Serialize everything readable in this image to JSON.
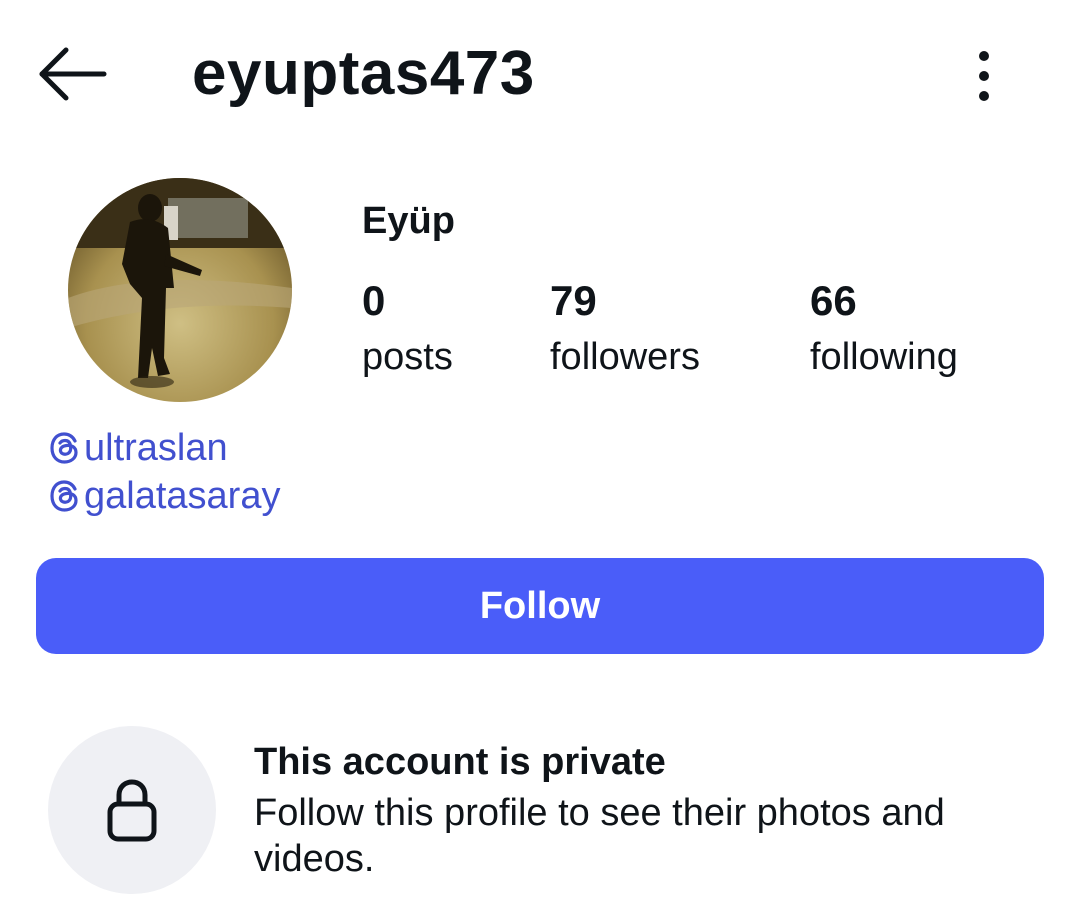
{
  "header": {
    "username": "eyuptas473",
    "back_icon": "arrow-left-icon",
    "menu_icon": "more-vertical-icon"
  },
  "profile": {
    "display_name": "Eyüp",
    "avatar": "profile-photo",
    "stats": [
      {
        "value": "0",
        "label": "posts"
      },
      {
        "value": "79",
        "label": "followers"
      },
      {
        "value": "66",
        "label": "following"
      }
    ],
    "threads_links": [
      {
        "icon": "threads-icon",
        "handle": "ultraslan"
      },
      {
        "icon": "threads-icon",
        "handle": "galatasaray"
      }
    ]
  },
  "actions": {
    "follow_label": "Follow"
  },
  "private_notice": {
    "icon": "lock-icon",
    "title": "This account is private",
    "description": "Follow this profile to see their photos and videos."
  },
  "colors": {
    "accent": "#4a5df9",
    "link": "#4150cf",
    "lock_bg": "#eff0f4",
    "text": "#0f1419"
  }
}
